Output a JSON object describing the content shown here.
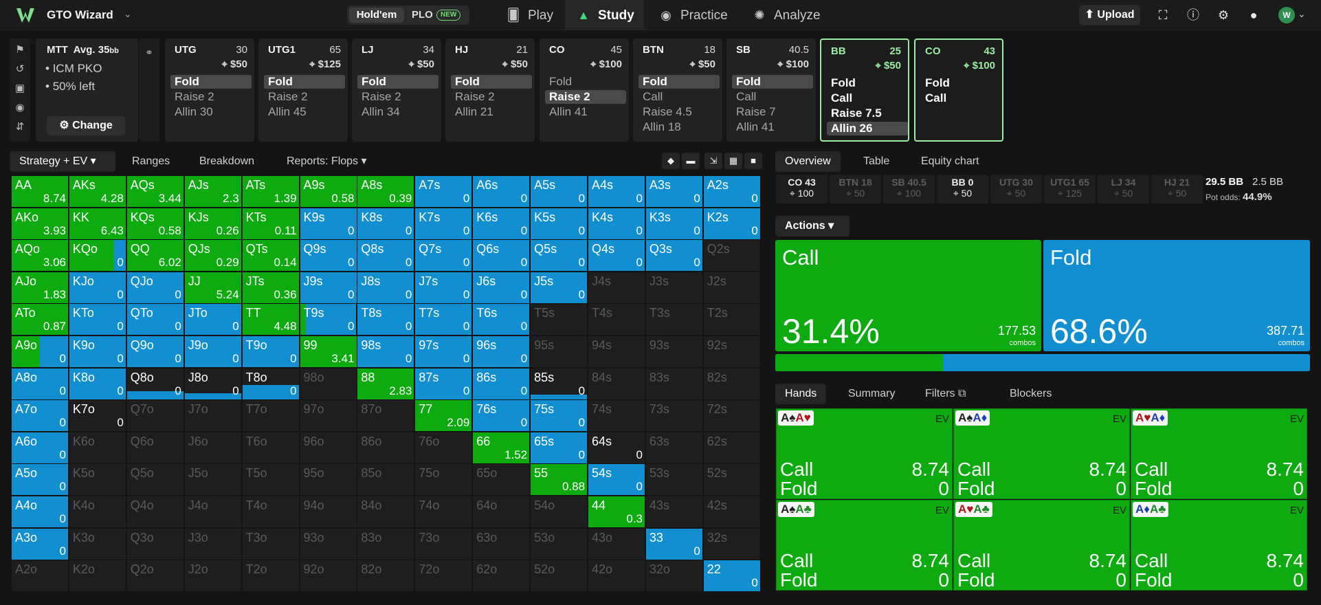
{
  "app": {
    "brand": "GTO Wizard",
    "game_modes": {
      "holdem": "Hold'em",
      "plo": "PLO",
      "plo_badge": "NEW"
    },
    "nav": [
      {
        "label": "Play",
        "icon": "cards-icon"
      },
      {
        "label": "Study",
        "icon": "graduation-cap-icon"
      },
      {
        "label": "Practice",
        "icon": "gamepad-icon"
      },
      {
        "label": "Analyze",
        "icon": "lightbulb-icon"
      }
    ],
    "upload_label": "Upload",
    "colors": {
      "call": "#0daa10",
      "fold": "#118fd0",
      "active_seat": "#97ef9f"
    }
  },
  "info": {
    "format": "MTT",
    "avg_label": "Avg. 35",
    "avg_unit": "bb",
    "bullets": [
      "ICM PKO",
      "50% left"
    ],
    "change_label": "Change"
  },
  "seats": [
    {
      "pos": "UTG",
      "stack": "30",
      "bounty": "$50",
      "actions": [
        "Fold",
        "Raise 2",
        "Allin 30"
      ],
      "selected": 0
    },
    {
      "pos": "UTG1",
      "stack": "65",
      "bounty": "$125",
      "actions": [
        "Fold",
        "Raise 2",
        "Allin 45"
      ],
      "selected": 0
    },
    {
      "pos": "LJ",
      "stack": "34",
      "bounty": "$50",
      "actions": [
        "Fold",
        "Raise 2",
        "Allin 34"
      ],
      "selected": 0
    },
    {
      "pos": "HJ",
      "stack": "21",
      "bounty": "$50",
      "actions": [
        "Fold",
        "Raise 2",
        "Allin 21"
      ],
      "selected": 0
    },
    {
      "pos": "CO",
      "stack": "45",
      "bounty": "$100",
      "actions": [
        "Fold",
        "Raise 2",
        "Allin 41"
      ],
      "selected": 1
    },
    {
      "pos": "BTN",
      "stack": "18",
      "bounty": "$50",
      "actions": [
        "Fold",
        "Call",
        "Raise 4.5",
        "Allin 18"
      ],
      "selected": 0
    },
    {
      "pos": "SB",
      "stack": "40.5",
      "bounty": "$100",
      "actions": [
        "Fold",
        "Call",
        "Raise 7",
        "Allin 41"
      ],
      "selected": 0
    },
    {
      "pos": "BB",
      "stack": "25",
      "bounty": "$50",
      "actions": [
        "Fold",
        "Call",
        "Raise 7.5",
        "Allin 26"
      ],
      "selected": 3
    },
    {
      "pos": "CO",
      "stack": "43",
      "bounty": "$100",
      "actions": [
        "Fold",
        "Call"
      ],
      "selected": -1
    }
  ],
  "grid_tabs": [
    "Strategy + EV",
    "Ranges",
    "Breakdown",
    "Reports: Flops"
  ],
  "ranks": [
    "A",
    "K",
    "Q",
    "J",
    "T",
    "9",
    "8",
    "7",
    "6",
    "5",
    "4",
    "3",
    "2"
  ],
  "grid_rows": [
    {
      "vals": [
        "8.74",
        "4.28",
        "3.44",
        "2.3",
        "1.39",
        "0.58",
        "0.39",
        "0",
        "0",
        "0",
        "0",
        "0",
        "0"
      ],
      "call": [
        1,
        1,
        1,
        1,
        1,
        1,
        1,
        0,
        0,
        0,
        0,
        0,
        0
      ]
    },
    {
      "vals": [
        "3.93",
        "6.43",
        "0.58",
        "0.26",
        "0.11",
        "0",
        "0",
        "0",
        "0",
        "0",
        "0",
        "0",
        "0"
      ],
      "call": [
        1,
        1,
        1,
        1,
        1,
        0,
        0,
        0,
        0,
        0,
        0,
        0,
        0
      ]
    },
    {
      "vals": [
        "3.06",
        "0",
        "6.02",
        "0.29",
        "0.14",
        "0",
        "0",
        "0",
        "0",
        "0",
        "0",
        "0",
        ""
      ],
      "call": [
        1,
        0.8,
        1,
        1,
        1,
        0,
        0,
        0,
        0,
        0,
        0,
        0,
        -1
      ]
    },
    {
      "vals": [
        "1.83",
        "0",
        "0",
        "5.24",
        "0.36",
        "0",
        "0",
        "0",
        "0",
        "0",
        "",
        "",
        ""
      ],
      "call": [
        1,
        0,
        0,
        1,
        1,
        0,
        0,
        0,
        0,
        0,
        -1,
        -1,
        -1
      ]
    },
    {
      "vals": [
        "0.87",
        "0",
        "0",
        "0",
        "4.48",
        "0",
        "0",
        "0",
        "0",
        "",
        "",
        "",
        ""
      ],
      "call": [
        1,
        0,
        0,
        0,
        1,
        0.1,
        0,
        0,
        0,
        -1,
        -1,
        -1,
        -1
      ]
    },
    {
      "vals": [
        "0",
        "0",
        "0",
        "0",
        "0",
        "3.41",
        "0",
        "0",
        "0",
        "",
        "",
        "",
        ""
      ],
      "call": [
        0.5,
        0,
        0,
        0,
        0,
        1,
        0,
        0,
        0,
        -1,
        -1,
        -1,
        -1
      ]
    },
    {
      "vals": [
        "0",
        "0",
        "0",
        "0",
        "0",
        "",
        "2.83",
        "0",
        "0",
        "0",
        "",
        "",
        ""
      ],
      "call": [
        0,
        0,
        0,
        0,
        0,
        -1,
        1,
        0,
        0,
        0,
        -1,
        -1,
        -1
      ]
    },
    {
      "vals": [
        "0",
        "0",
        "",
        "",
        "",
        "",
        "",
        "2.09",
        "0",
        "0",
        "",
        "",
        ""
      ],
      "call": [
        0,
        2,
        -1,
        -1,
        -1,
        -1,
        -1,
        1,
        0,
        0,
        -1,
        -1,
        -1
      ]
    },
    {
      "vals": [
        "0",
        "",
        "",
        "",
        "",
        "",
        "",
        "",
        "1.52",
        "0",
        "0",
        "",
        ""
      ],
      "call": [
        0,
        -1,
        -1,
        -1,
        -1,
        -1,
        -1,
        -1,
        1,
        0,
        2,
        -1,
        -1
      ]
    },
    {
      "vals": [
        "0",
        "",
        "",
        "",
        "",
        "",
        "",
        "",
        "",
        "0.88",
        "0",
        "",
        ""
      ],
      "call": [
        0,
        -1,
        -1,
        -1,
        -1,
        -1,
        -1,
        -1,
        -1,
        1,
        0,
        -1,
        -1
      ]
    },
    {
      "vals": [
        "0",
        "",
        "",
        "",
        "",
        "",
        "",
        "",
        "",
        "",
        "0.3",
        "",
        ""
      ],
      "call": [
        0,
        -1,
        -1,
        -1,
        -1,
        -1,
        -1,
        -1,
        -1,
        -1,
        1,
        -1,
        -1
      ]
    },
    {
      "vals": [
        "0",
        "",
        "",
        "",
        "",
        "",
        "",
        "",
        "",
        "",
        "",
        "0",
        ""
      ],
      "call": [
        0,
        -1,
        -1,
        -1,
        -1,
        -1,
        -1,
        -1,
        -1,
        -1,
        -1,
        0,
        -1
      ]
    },
    {
      "vals": [
        "",
        "",
        "",
        "",
        "",
        "",
        "",
        "",
        "",
        "",
        "",
        "",
        "0"
      ],
      "call": [
        -1,
        -1,
        -1,
        -1,
        -1,
        -1,
        -1,
        -1,
        -1,
        -1,
        -1,
        -1,
        0
      ]
    }
  ],
  "partial": {
    "Q8o": 0.25,
    "J8o": 0.2,
    "T8o": 0.45,
    "85s": 0.15,
    "64s": 0.1
  },
  "right_tabs": [
    "Overview",
    "Table",
    "Equity chart"
  ],
  "positions_strip": [
    {
      "pos": "CO 43",
      "bounty": "100",
      "hl": true
    },
    {
      "pos": "BTN 18",
      "bounty": "50",
      "hl": false
    },
    {
      "pos": "SB 40.5",
      "bounty": "100",
      "hl": false
    },
    {
      "pos": "BB 0",
      "bounty": "50",
      "hl": true
    },
    {
      "pos": "UTG 30",
      "bounty": "50",
      "hl": false
    },
    {
      "pos": "UTG1 65",
      "bounty": "125",
      "hl": false
    },
    {
      "pos": "LJ 34",
      "bounty": "50",
      "hl": false
    },
    {
      "pos": "HJ 21",
      "bounty": "50",
      "hl": false
    }
  ],
  "pot": {
    "bb": "29.5 BB",
    "bb2": "2.5 BB",
    "odds_label": "Pot odds:",
    "odds": "44.9%"
  },
  "actions_label": "Actions",
  "summary": [
    {
      "name": "Call",
      "pct": "31.4%",
      "combos": "177.53",
      "combos_label": "combos",
      "freq": 0.314
    },
    {
      "name": "Fold",
      "pct": "68.6%",
      "combos": "387.71",
      "combos_label": "combos",
      "freq": 0.686
    }
  ],
  "hand_tabs": [
    "Hands",
    "Summary",
    "Filters",
    "Blockers"
  ],
  "hands": [
    {
      "c1": "A",
      "s1": "♠",
      "k1": "cblk",
      "c2": "A",
      "s2": "♥",
      "k2": "cred",
      "call": "8.74",
      "fold": "0"
    },
    {
      "c1": "A",
      "s1": "♠",
      "k1": "cblk",
      "c2": "A",
      "s2": "♦",
      "k2": "cblu",
      "call": "8.74",
      "fold": "0"
    },
    {
      "c1": "A",
      "s1": "♥",
      "k1": "cred",
      "c2": "A",
      "s2": "♦",
      "k2": "cblu",
      "call": "8.74",
      "fold": "0"
    },
    {
      "c1": "A",
      "s1": "♠",
      "k1": "cblk",
      "c2": "A",
      "s2": "♣",
      "k2": "cgrn",
      "call": "8.74",
      "fold": "0"
    },
    {
      "c1": "A",
      "s1": "♥",
      "k1": "cred",
      "c2": "A",
      "s2": "♣",
      "k2": "cgrn",
      "call": "8.74",
      "fold": "0"
    },
    {
      "c1": "A",
      "s1": "♦",
      "k1": "cblu",
      "c2": "A",
      "s2": "♣",
      "k2": "cgrn",
      "call": "8.74",
      "fold": "0"
    }
  ],
  "hand_labels": {
    "ev": "EV",
    "call": "Call",
    "fold": "Fold"
  }
}
